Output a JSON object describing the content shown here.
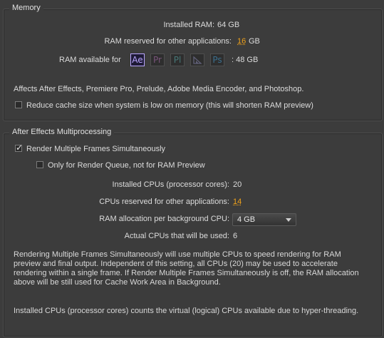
{
  "memory": {
    "title": "Memory",
    "installed_ram_label": "Installed RAM:",
    "installed_ram_value": "64 GB",
    "reserved_label": "RAM reserved for other applications:",
    "reserved_value": "16",
    "reserved_unit": "GB",
    "available_label": "RAM available for",
    "available_value": ": 48 GB",
    "apps": [
      {
        "abbr": "Ae",
        "name": "After Effects",
        "color": "#b9a6ff",
        "active": true
      },
      {
        "abbr": "Pr",
        "name": "Premiere Pro",
        "color": "#8d5b8f",
        "active": false
      },
      {
        "abbr": "Pl",
        "name": "Prelude",
        "color": "#4a8a8a",
        "active": false
      },
      {
        "abbr": "Me",
        "name": "Media Encoder",
        "color": "#6b6b8a",
        "active": false
      },
      {
        "abbr": "Ps",
        "name": "Photoshop",
        "color": "#3a7fa8",
        "active": false
      }
    ],
    "affects_text": "Affects After Effects, Premiere Pro, Prelude, Adobe Media Encoder, and Photoshop.",
    "reduce_cache_label": "Reduce cache size when system is low on memory (this will shorten RAM preview)",
    "reduce_cache_checked": false
  },
  "multiprocessing": {
    "title": "After Effects Multiprocessing",
    "render_multiple_label": "Render Multiple Frames Simultaneously",
    "render_multiple_checked": true,
    "render_queue_only_label": "Only for Render Queue, not for RAM Preview",
    "render_queue_only_checked": false,
    "installed_cpus_label": "Installed CPUs (processor cores):",
    "installed_cpus_value": "20",
    "reserved_cpus_label": "CPUs reserved for other applications:",
    "reserved_cpus_value": "14",
    "ram_per_cpu_label": "RAM allocation per background CPU:",
    "ram_per_cpu_value": "4 GB",
    "actual_cpus_label": "Actual CPUs that will be used:",
    "actual_cpus_value": "6",
    "description": "Rendering Multiple Frames Simultaneously will use multiple CPUs to speed rendering for RAM preview and final output. Independent of this setting, all CPUs (20) may be used to accelerate rendering within a single frame. If Render Multiple Frames Simultaneously is off, the RAM allocation above will be still used for Cache Work Area in Background.",
    "note": "Installed CPUs (processor cores) counts the virtual (logical) CPUs available due to hyper-threading."
  }
}
